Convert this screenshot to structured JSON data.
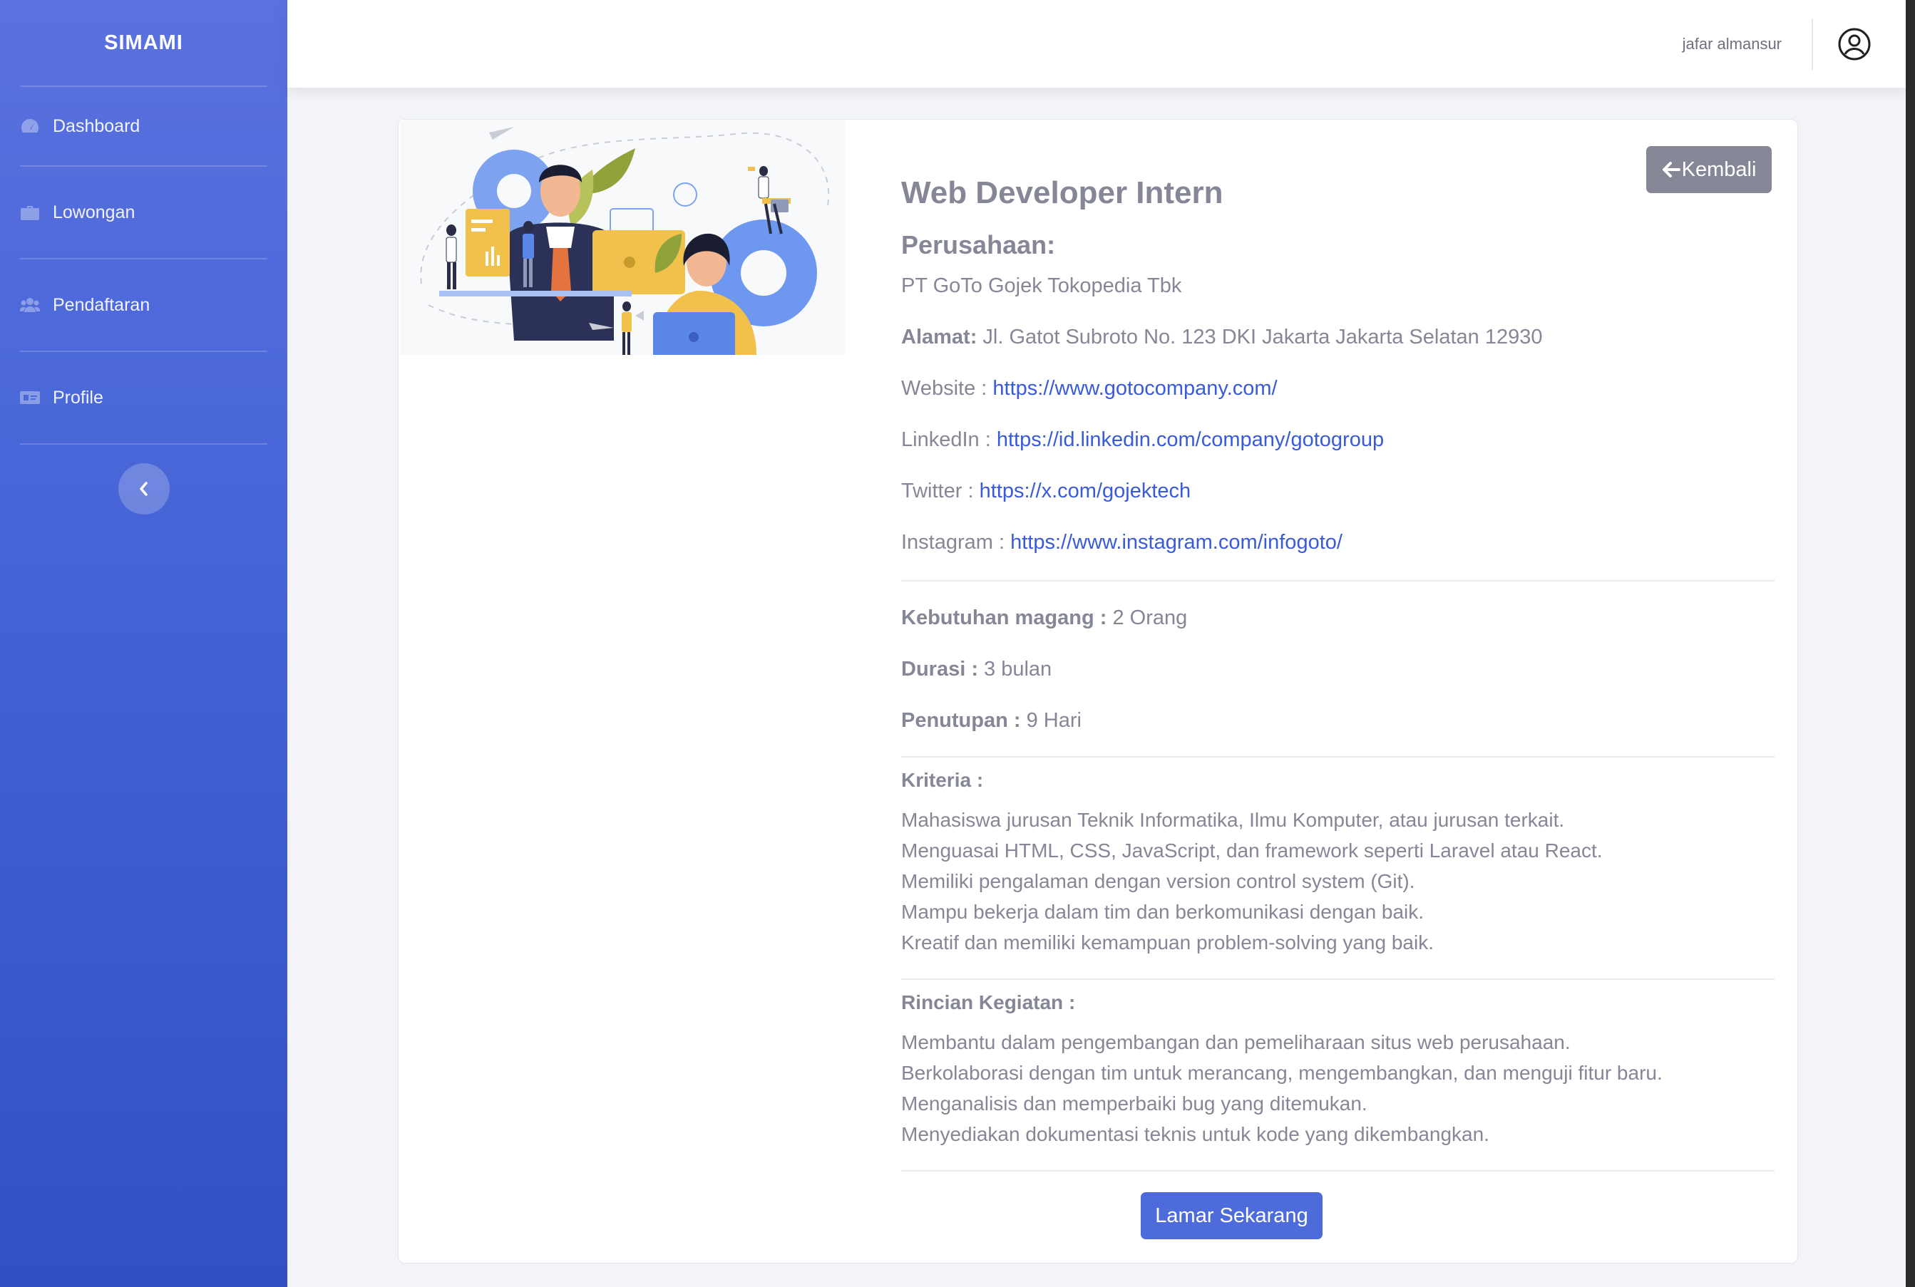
{
  "app": {
    "brand": "SIMAMI",
    "accent_color": "#4e6bdc"
  },
  "sidebar": {
    "items": [
      {
        "label": "Dashboard",
        "icon": "tachometer-icon"
      },
      {
        "label": "Lowongan",
        "icon": "briefcase-icon"
      },
      {
        "label": "Pendaftaran",
        "icon": "users-icon"
      },
      {
        "label": "Profile",
        "icon": "id-card-icon"
      }
    ],
    "toggle_icon": "chevron-left-icon"
  },
  "topbar": {
    "username": "jafar almansur",
    "avatar_icon": "user-circle-icon"
  },
  "job": {
    "back_label": "Kembali",
    "title": "Web Developer Intern",
    "company_heading": "Perusahaan:",
    "company_name": "PT GoTo Gojek Tokopedia Tbk",
    "address_label": "Alamat:",
    "address": "Jl. Gatot Subroto No. 123 DKI Jakarta Jakarta Selatan 12930",
    "website_label": "Website :",
    "website": "https://www.gotocompany.com/",
    "linkedin_label": "LinkedIn :",
    "linkedin": "https://id.linkedin.com/company/gotogroup",
    "twitter_label": "Twitter :",
    "twitter": "https://x.com/gojektech",
    "instagram_label": "Instagram :",
    "instagram": "https://www.instagram.com/infogoto/",
    "needs_label": "Kebutuhan magang :",
    "needs": "2 Orang",
    "duration_label": "Durasi :",
    "duration": "3 bulan",
    "closing_label": "Penutupan :",
    "closing": "9 Hari",
    "criteria_label": "Kriteria :",
    "criteria": [
      "Mahasiswa jurusan Teknik Informatika, Ilmu Komputer, atau jurusan terkait.",
      "Menguasai HTML, CSS, JavaScript, dan framework seperti Laravel atau React.",
      "Memiliki pengalaman dengan version control system (Git).",
      "Mampu bekerja dalam tim dan berkomunikasi dengan baik.",
      "Kreatif dan memiliki kemampuan problem-solving yang baik."
    ],
    "activities_label": "Rincian Kegiatan :",
    "activities": [
      "Membantu dalam pengembangan dan pemeliharaan situs web perusahaan.",
      "Berkolaborasi dengan tim untuk merancang, mengembangkan, dan menguji fitur baru.",
      "Menganalisis dan memperbaiki bug yang ditemukan.",
      "Menyediakan dokumentasi teknis untuk kode yang dikembangkan."
    ],
    "apply_label": "Lamar Sekarang"
  }
}
